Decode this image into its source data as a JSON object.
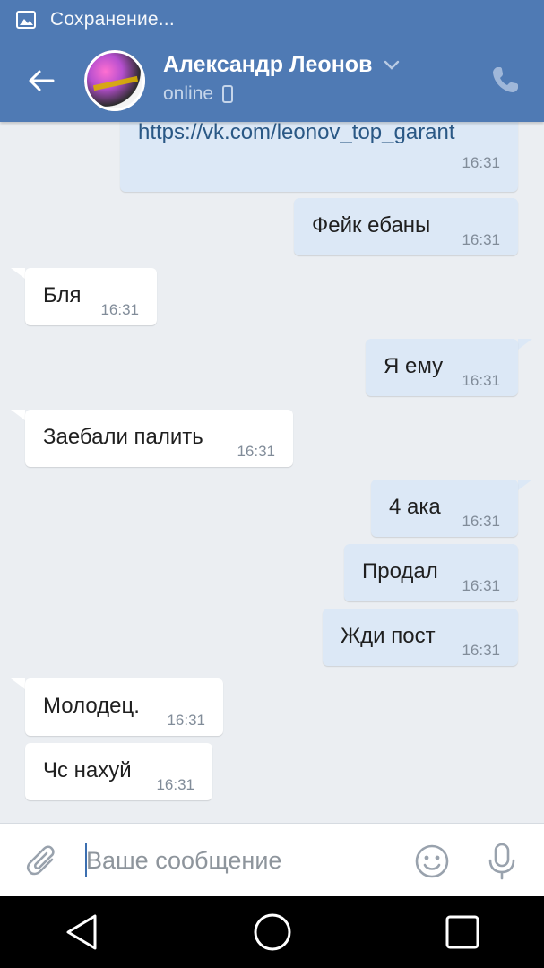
{
  "status_bar": {
    "text": "Сохранение..."
  },
  "header": {
    "contact_name": "Александр Леонов",
    "presence": "online"
  },
  "messages": [
    {
      "dir": "out",
      "text": "https://vk.com/leonov_top_garant",
      "time": "16:31",
      "is_link": true
    },
    {
      "dir": "out",
      "text": "Фейк ебаны",
      "time": "16:31"
    },
    {
      "dir": "in",
      "text": "Бля",
      "time": "16:31"
    },
    {
      "dir": "out",
      "text": "Я ему",
      "time": "16:31"
    },
    {
      "dir": "in",
      "text": "Заебали палить",
      "time": "16:31"
    },
    {
      "dir": "out",
      "text": "4 ака",
      "time": "16:31"
    },
    {
      "dir": "out",
      "text": "Продал",
      "time": "16:31"
    },
    {
      "dir": "out",
      "text": "Жди пост",
      "time": "16:31"
    },
    {
      "dir": "in",
      "text": "Молодец.",
      "time": "16:31"
    },
    {
      "dir": "in",
      "text": "Чс нахуй",
      "time": "16:31"
    }
  ],
  "composer": {
    "placeholder": "Ваше сообщение"
  },
  "icons": {
    "status": "image-icon",
    "back": "arrow-left-icon",
    "call": "phone-icon",
    "attach": "paperclip-icon",
    "emoji": "smile-icon",
    "mic": "microphone-icon"
  },
  "colors": {
    "header_bg": "#4f7ab4",
    "chat_bg": "#ebeef2",
    "incoming_bubble": "#ffffff",
    "outgoing_bubble": "#dce8f6",
    "link": "#2a5885",
    "time": "#818c99"
  }
}
